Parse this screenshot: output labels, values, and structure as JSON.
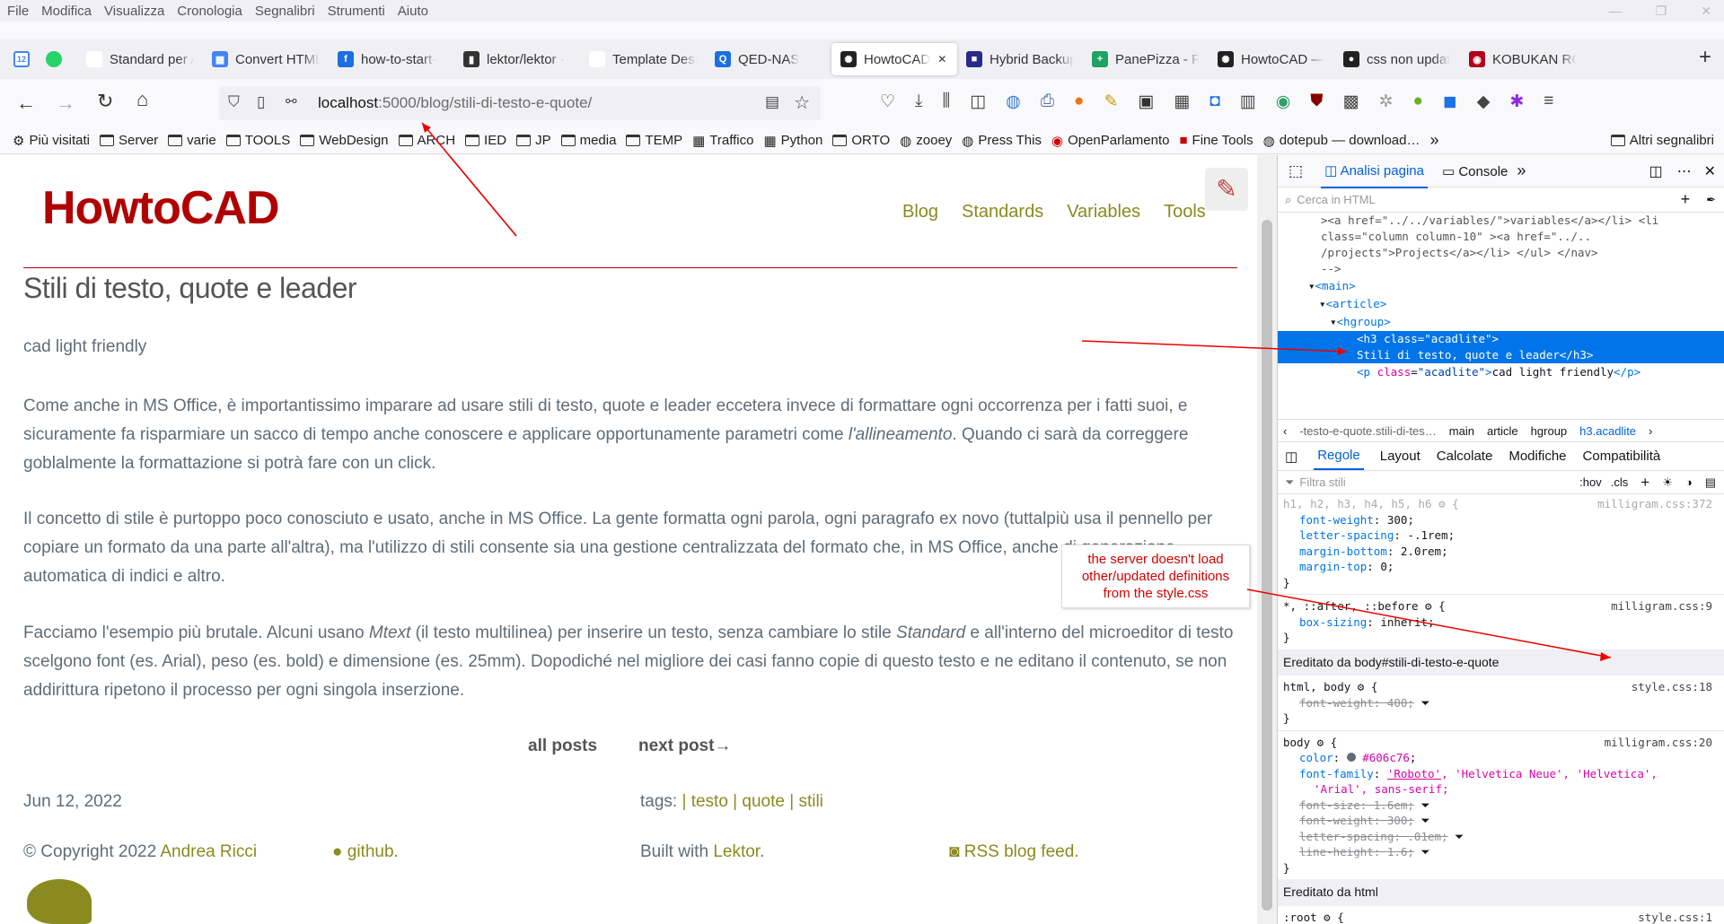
{
  "menu": [
    "File",
    "Modifica",
    "Visualizza",
    "Cronologia",
    "Segnalibri",
    "Strumenti",
    "Aiuto"
  ],
  "tabs": [
    {
      "title": "Standard per Auto",
      "fav": "",
      "color": "#fff"
    },
    {
      "title": "Convert HTML",
      "fav": "▦",
      "color": "#4285f4"
    },
    {
      "title": "how-to-start-",
      "fav": "f",
      "color": "#1d6fe0"
    },
    {
      "title": "lektor/lektor ·",
      "fav": "▮",
      "color": "#333"
    },
    {
      "title": "Template Designe",
      "fav": "",
      "color": "#fff"
    },
    {
      "title": "QED-NAS",
      "fav": "Q",
      "color": "#1d6fe0"
    },
    {
      "title": "HowtoCAD",
      "fav": "✺",
      "color": "#222",
      "active": true
    },
    {
      "title": "Hybrid Backup",
      "fav": "■",
      "color": "#2a2a8a"
    },
    {
      "title": "PanePizza - Fo",
      "fav": "+",
      "color": "#1ea362"
    },
    {
      "title": "HowtoCAD —",
      "fav": "✺",
      "color": "#222"
    },
    {
      "title": "css non updat",
      "fav": "●",
      "color": "#222"
    },
    {
      "title": "KOBUKAN RO",
      "fav": "◉",
      "color": "#b0001c"
    }
  ],
  "url": {
    "host": "localhost",
    "rest": ":5000/blog/stili-di-testo-e-quote/"
  },
  "bookmarks": [
    "Più visitati",
    "Server",
    "varie",
    "TOOLS",
    "WebDesign",
    "ARCH",
    "IED",
    "JP",
    "media",
    "TEMP",
    "Traffico",
    "Python",
    "ORTO",
    "zooey",
    "Press This",
    "OpenParlamento",
    "Fine Tools",
    "dotepub — download…",
    "Altri segnalibri"
  ],
  "site": {
    "logo": "HowtoCAD",
    "nav": [
      "Blog",
      "Standards",
      "Variables",
      "Tools"
    ],
    "title": "Stili di testo, quote e leader",
    "subtitle": "cad light friendly",
    "p1": "Come anche in MS Office, è importantissimo imparare ad usare stili di testo, quote e leader eccetera invece di formattare ogni occorrenza per i fatti suoi, e sicuramente fa risparmiare un sacco di tempo anche conoscere e applicare opportunamente parametri come ",
    "p1em": "l'allineamento",
    "p1b": ". Quando ci sarà da correggere goblalmente la formattazione si potrà fare con un click.",
    "p2": "Il concetto di stile è purtoppo poco conosciuto e usato, anche in MS Office. La gente formatta ogni parola, ogni paragrafo ex novo (tuttalpiù usa il pennello per copiare un formato da una parte all'altra), ma l'utilizzo di stili consente sia una gestione centralizzata del formato che, in MS Office, anche di generazione automatica di indici e altro.",
    "p3a": "Facciamo l'esempio più brutale. Alcuni usano ",
    "p3em1": "Mtext",
    "p3b": " (il testo multilinea) per inserire un testo, senza cambiare lo stile ",
    "p3em2": "Standard",
    "p3c": " e all'interno del microeditor di testo scelgono font (es. Arial), peso (es. bold) e dimensione (es. 25mm). Dopodiché nel migliore dei casi fanno copie di questo testo e ne editano il contenuto, se non addirittura ripetono il processo per ogni singola inserzione.",
    "all_posts": "all posts",
    "next_post": "next post→",
    "date": "Jun 12, 2022",
    "tags_label": "tags: ",
    "tags": [
      "testo",
      "quote",
      "stili"
    ],
    "copyright": "© Copyright 2022 ",
    "author": "Andrea Ricci",
    "github": "github.",
    "built": "Built with ",
    "lektor": "Lektor",
    "rss": "RSS blog feed."
  },
  "devtools": {
    "tabs": [
      "Analisi pagina",
      "Console"
    ],
    "search_placeholder": "Cerca in HTML",
    "html_lines": [
      "><a href=\"../../variables/\">variables</a></li> <li",
      "class=\"column column-10\" ><a href=\"../..",
      "/projects\">Projects</a></li> </ul> </nav>",
      "-->"
    ],
    "breadcrumb": [
      "-testo-e-quote.stili-di-tes…",
      "main",
      "article",
      "hgroup",
      "h3.acadlite"
    ],
    "rule_tabs": [
      "Regole",
      "Layout",
      "Calcolate",
      "Modifiche",
      "Compatibilità"
    ],
    "filter_placeholder": "Filtra stili",
    "inherited_body": "Ereditato da body#stili-di-testo-e-quote",
    "inherited_html": "Ereditato da html",
    "annotation": "the server doesn't load other/updated definitions from the style.css"
  }
}
